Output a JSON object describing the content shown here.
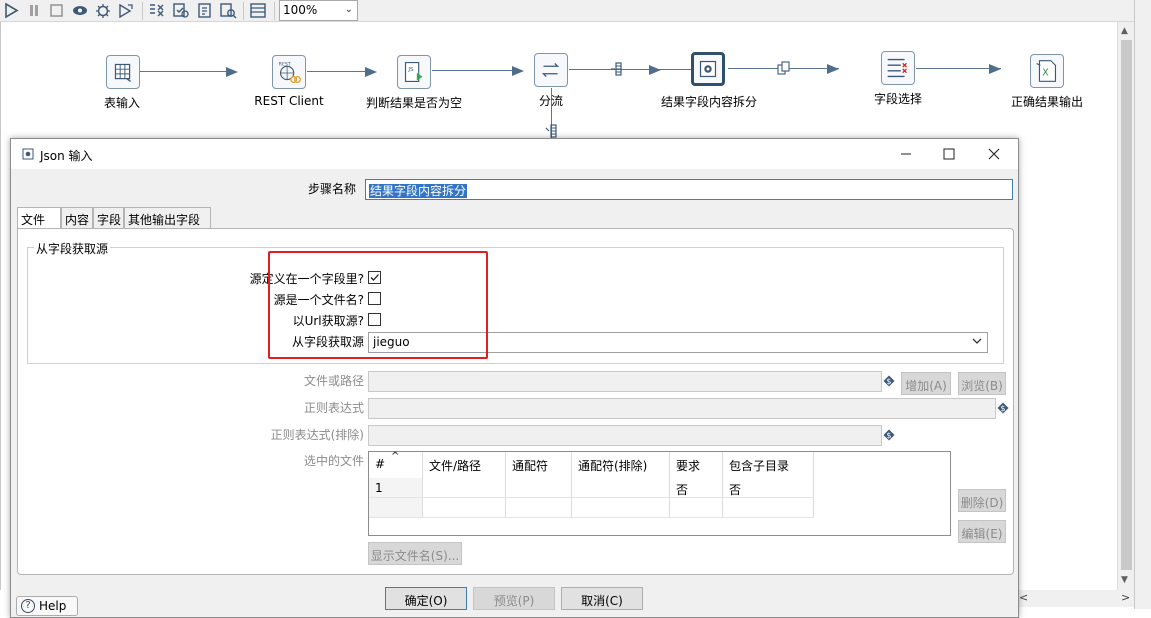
{
  "toolbar": {
    "icons": [
      "run-icon",
      "pause-icon",
      "stop-icon",
      "preview-icon",
      "debug-icon",
      "replay-icon",
      "verify-icon",
      "analyze-impact-icon",
      "sql-icon",
      "explore-db-icon",
      "results-panel-icon"
    ],
    "zoom": "100%"
  },
  "canvas": {
    "steps": [
      {
        "label": "表输入",
        "icon": "table-input-icon"
      },
      {
        "label": "REST Client",
        "icon": "rest-client-icon"
      },
      {
        "label": "判断结果是否为空",
        "icon": "javascript-icon"
      },
      {
        "label": "分流",
        "icon": "switch-icon"
      },
      {
        "label": "结果字段内容拆分",
        "icon": "json-input-icon"
      },
      {
        "label": "字段选择",
        "icon": "select-values-icon"
      },
      {
        "label": "正确结果输出",
        "icon": "excel-output-icon"
      }
    ]
  },
  "dialog": {
    "title": "Json 输入",
    "step_name_label": "步骤名称",
    "step_name_value": "结果字段内容拆分",
    "tabs": [
      "文件",
      "内容",
      "字段",
      "其他输出字段"
    ],
    "active_tab": "文件",
    "group_title": "从字段获取源",
    "source_in_field_label": "源定义在一个字段里?",
    "source_in_field_checked": true,
    "source_is_filename_label": "源是一个文件名?",
    "source_is_filename_checked": false,
    "read_url_label": "以Url获取源?",
    "read_url_checked": false,
    "source_field_label": "从字段获取源",
    "source_field_value": "jieguo",
    "file_path_label": "文件或路径",
    "regex_label": "正则表达式",
    "regex_exclude_label": "正则表达式(排除)",
    "selected_files_label": "选中的文件",
    "add_button": "增加(A)",
    "browse_button": "浏览(B)",
    "delete_button": "删除(D)",
    "edit_button": "编辑(E)",
    "show_filenames_button": "显示文件名(S)...",
    "table": {
      "columns": [
        "#",
        "文件/路径",
        "通配符",
        "通配符(排除)",
        "要求",
        "包含子目录"
      ],
      "rows": [
        [
          "1",
          "",
          "",
          "",
          "否",
          "否"
        ],
        [
          "",
          "",
          "",
          "",
          "",
          ""
        ]
      ]
    },
    "ok_button": "确定(O)",
    "preview_button": "预览(P)",
    "cancel_button": "取消(C)",
    "help_button": "Help"
  },
  "colors": {
    "highlight_box": "#e02020",
    "selection": "#3375c4",
    "hop_line": "#5a7791"
  }
}
